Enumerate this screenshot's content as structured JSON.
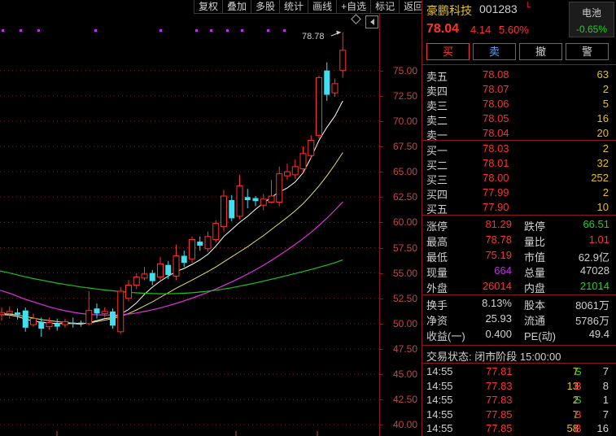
{
  "toolbar": {
    "items": [
      "复权",
      "叠加",
      "多股",
      "统计",
      "画线",
      "+自选",
      "标记",
      "返回"
    ]
  },
  "colors": {
    "up": "#ff3030",
    "down": "#40e0f0",
    "ma5": "#ffffff",
    "ma10": "#e8e060",
    "ma20": "#e030e0",
    "ma60": "#20c020",
    "marker": "#c030e0",
    "grid": "#8a1a1a"
  },
  "chart": {
    "high_label": "78.78",
    "y_ticks": [
      "75.00",
      "72.50",
      "70.00",
      "67.50",
      "65.00",
      "62.50",
      "60.00",
      "57.50",
      "55.00",
      "52.50",
      "50.00",
      "47.50",
      "45.00",
      "42.50",
      "40.00"
    ]
  },
  "chart_data": {
    "type": "candlestick",
    "ylim": [
      38.9,
      80.6
    ],
    "y_ticks": [
      75.0,
      72.5,
      70.0,
      67.5,
      65.0,
      62.5,
      60.0,
      57.5,
      55.0,
      52.5,
      50.0,
      47.5,
      45.0,
      42.5,
      40.0
    ],
    "high_annotation": 78.78,
    "candles": [
      {
        "o": 50.9,
        "c": 51.1,
        "h": 51.6,
        "l": 50.3
      },
      {
        "o": 51.0,
        "c": 51.2,
        "h": 51.7,
        "l": 50.5
      },
      {
        "o": 51.1,
        "c": 50.9,
        "h": 51.5,
        "l": 50.4
      },
      {
        "o": 51.3,
        "c": 49.6,
        "h": 51.6,
        "l": 49.2
      },
      {
        "o": 49.9,
        "c": 50.5,
        "h": 51.0,
        "l": 49.7
      },
      {
        "o": 50.2,
        "c": 49.5,
        "h": 50.6,
        "l": 48.7
      },
      {
        "o": 49.7,
        "c": 50.1,
        "h": 50.6,
        "l": 49.4
      },
      {
        "o": 50.0,
        "c": 49.7,
        "h": 50.5,
        "l": 49.3
      },
      {
        "o": 49.9,
        "c": 50.2,
        "h": 50.5,
        "l": 49.6
      },
      {
        "o": 50.1,
        "c": 50.0,
        "h": 50.6,
        "l": 49.6
      },
      {
        "o": 50.1,
        "c": 50.0,
        "h": 50.3,
        "l": 49.7
      },
      {
        "o": 50.0,
        "c": 51.3,
        "h": 53.2,
        "l": 49.8
      },
      {
        "o": 51.5,
        "c": 51.0,
        "h": 52.0,
        "l": 50.5
      },
      {
        "o": 51.0,
        "c": 51.2,
        "h": 51.6,
        "l": 50.6
      },
      {
        "o": 51.2,
        "c": 49.8,
        "h": 51.5,
        "l": 49.5
      },
      {
        "o": 49.2,
        "c": 53.2,
        "h": 53.6,
        "l": 49.0
      },
      {
        "o": 52.5,
        "c": 53.8,
        "h": 54.3,
        "l": 52.2
      },
      {
        "o": 53.8,
        "c": 54.6,
        "h": 55.0,
        "l": 53.4
      },
      {
        "o": 54.5,
        "c": 54.9,
        "h": 55.6,
        "l": 54.3
      },
      {
        "o": 55.0,
        "c": 54.2,
        "h": 55.3,
        "l": 53.8
      },
      {
        "o": 54.6,
        "c": 55.9,
        "h": 56.6,
        "l": 54.3
      },
      {
        "o": 55.8,
        "c": 54.8,
        "h": 56.2,
        "l": 54.4
      },
      {
        "o": 54.7,
        "c": 56.7,
        "h": 57.8,
        "l": 54.3
      },
      {
        "o": 56.7,
        "c": 56.0,
        "h": 57.2,
        "l": 55.6
      },
      {
        "o": 56.4,
        "c": 58.3,
        "h": 58.6,
        "l": 56.0
      },
      {
        "o": 58.1,
        "c": 57.7,
        "h": 58.6,
        "l": 57.2
      },
      {
        "o": 57.4,
        "c": 58.6,
        "h": 59.1,
        "l": 57.1
      },
      {
        "o": 58.3,
        "c": 59.9,
        "h": 60.2,
        "l": 58.0
      },
      {
        "o": 59.6,
        "c": 62.6,
        "h": 63.2,
        "l": 59.1
      },
      {
        "o": 62.2,
        "c": 60.4,
        "h": 62.7,
        "l": 60.1
      },
      {
        "o": 60.6,
        "c": 63.6,
        "h": 64.7,
        "l": 60.3
      },
      {
        "o": 62.5,
        "c": 62.2,
        "h": 63.3,
        "l": 61.4
      },
      {
        "o": 62.4,
        "c": 62.1,
        "h": 62.6,
        "l": 61.6
      },
      {
        "o": 61.7,
        "c": 62.3,
        "h": 62.8,
        "l": 61.2
      },
      {
        "o": 62.0,
        "c": 62.6,
        "h": 64.2,
        "l": 61.9
      },
      {
        "o": 62.0,
        "c": 64.8,
        "h": 65.5,
        "l": 61.6
      },
      {
        "o": 64.6,
        "c": 65.0,
        "h": 65.8,
        "l": 64.2
      },
      {
        "o": 64.7,
        "c": 65.5,
        "h": 66.2,
        "l": 64.3
      },
      {
        "o": 65.3,
        "c": 66.8,
        "h": 67.5,
        "l": 65.0
      },
      {
        "o": 66.6,
        "c": 68.1,
        "h": 68.6,
        "l": 66.3
      },
      {
        "o": 68.6,
        "c": 74.3,
        "h": 74.5,
        "l": 68.3
      },
      {
        "o": 75.0,
        "c": 72.6,
        "h": 75.8,
        "l": 72.0
      },
      {
        "o": 72.8,
        "c": 73.7,
        "h": 74.2,
        "l": 72.4
      },
      {
        "o": 75.0,
        "c": 77.0,
        "h": 78.78,
        "l": 74.3
      }
    ],
    "ma": [
      {
        "name": "MA5",
        "values": [
          50.9,
          50.85,
          50.7,
          50.45,
          50.25,
          50.15,
          50.05,
          50.0,
          50.0,
          50.0,
          49.95,
          50.1,
          50.3,
          50.5,
          50.6,
          50.95,
          51.4,
          52.05,
          52.9,
          53.6,
          54.2,
          54.7,
          55.15,
          55.45,
          55.85,
          56.3,
          56.85,
          57.65,
          58.6,
          59.3,
          60.0,
          60.6,
          61.3,
          61.9,
          62.5,
          63.0,
          63.4,
          64.0,
          64.9,
          66.4,
          68.1,
          69.4,
          70.5,
          72.0
        ]
      },
      {
        "name": "MA10",
        "values": [
          51.0,
          50.95,
          50.85,
          50.7,
          50.55,
          50.4,
          50.3,
          50.2,
          50.12,
          50.05,
          50.0,
          50.05,
          50.2,
          50.35,
          50.5,
          50.72,
          51.0,
          51.35,
          51.75,
          52.15,
          52.6,
          53.05,
          53.5,
          53.9,
          54.3,
          54.72,
          55.15,
          55.6,
          56.1,
          56.6,
          57.1,
          57.6,
          58.15,
          58.7,
          59.3,
          59.9,
          60.5,
          61.15,
          61.85,
          62.7,
          63.6,
          64.6,
          65.7,
          66.9
        ]
      },
      {
        "name": "MA20",
        "values": [
          53.3,
          53.0,
          52.7,
          52.4,
          52.15,
          51.9,
          51.65,
          51.45,
          51.27,
          51.12,
          51.0,
          50.92,
          50.87,
          50.85,
          50.85,
          50.88,
          50.95,
          51.05,
          51.2,
          51.37,
          51.55,
          51.77,
          52.0,
          52.25,
          52.52,
          52.8,
          53.1,
          53.42,
          53.77,
          54.12,
          54.5,
          54.9,
          55.32,
          55.77,
          56.25,
          56.75,
          57.27,
          57.82,
          58.4,
          59.02,
          59.7,
          60.42,
          61.2,
          62.02
        ]
      },
      {
        "name": "MA60",
        "values": [
          55.2,
          55.0,
          54.8,
          54.62,
          54.45,
          54.3,
          54.15,
          54.0,
          53.87,
          53.75,
          53.62,
          53.52,
          53.42,
          53.32,
          53.24,
          53.16,
          53.1,
          53.04,
          53.0,
          52.97,
          52.95,
          52.95,
          52.97,
          53.0,
          53.05,
          53.12,
          53.2,
          53.3,
          53.42,
          53.55,
          53.7,
          53.85,
          54.02,
          54.2,
          54.38,
          54.56,
          54.75,
          54.95,
          55.15,
          55.35,
          55.56,
          55.78,
          56.02,
          56.3
        ]
      }
    ]
  },
  "stock": {
    "name": "豪鹏科技",
    "code": "001283",
    "flag": "L",
    "price": "78.04",
    "change": "4.14",
    "change_pct": "5.60%",
    "sector_name": "电池",
    "sector_change": "-0.65%"
  },
  "buttons": {
    "buy": "买",
    "sell": "卖",
    "cancel": "撤",
    "alert": "警"
  },
  "asks": [
    {
      "label": "卖五",
      "price": "78.08",
      "vol": "63"
    },
    {
      "label": "卖四",
      "price": "78.07",
      "vol": "2"
    },
    {
      "label": "卖三",
      "price": "78.06",
      "vol": "5"
    },
    {
      "label": "卖二",
      "price": "78.05",
      "vol": "16"
    },
    {
      "label": "卖一",
      "price": "78.04",
      "vol": "20"
    }
  ],
  "bids": [
    {
      "label": "买一",
      "price": "78.03",
      "vol": "2"
    },
    {
      "label": "买二",
      "price": "78.01",
      "vol": "32"
    },
    {
      "label": "买三",
      "price": "78.00",
      "vol": "252"
    },
    {
      "label": "买四",
      "price": "77.99",
      "vol": "2"
    },
    {
      "label": "买五",
      "price": "77.90",
      "vol": "10"
    }
  ],
  "quote": [
    {
      "l1": "涨停",
      "v1": "81.29",
      "c1": "red",
      "l2": "跌停",
      "v2": "66.51",
      "c2": "green"
    },
    {
      "l1": "最高",
      "v1": "78.78",
      "c1": "red",
      "l2": "量比",
      "v2": "1.01",
      "c2": "red"
    },
    {
      "l1": "最低",
      "v1": "75.19",
      "c1": "red",
      "l2": "市值",
      "v2": "62.9亿",
      "c2": "white"
    },
    {
      "l1": "现量",
      "v1": "664",
      "c1": "purple",
      "l2": "总量",
      "v2": "47028",
      "c2": "white"
    },
    {
      "l1": "外盘",
      "v1": "26014",
      "c1": "red",
      "l2": "内盘",
      "v2": "21014",
      "c2": "green"
    }
  ],
  "fundamentals": [
    {
      "l1": "换手",
      "v1": "8.13%",
      "l2": "股本",
      "v2": "8061万"
    },
    {
      "l1": "净资",
      "v1": "25.93",
      "l2": "流通",
      "v2": "5786万"
    },
    {
      "l1": "收益(一)",
      "v1": "0.400",
      "l2": "PE(动)",
      "v2": "49.4"
    }
  ],
  "status": {
    "label": "交易状态:",
    "value": "闭市阶段 15:00:00"
  },
  "ticks": [
    {
      "time": "14:55",
      "price": "77.81",
      "vol": "7",
      "side": "S",
      "count": "7"
    },
    {
      "time": "14:55",
      "price": "77.83",
      "vol": "13",
      "side": "B",
      "count": "8"
    },
    {
      "time": "14:55",
      "price": "77.83",
      "vol": "2",
      "side": "S",
      "count": "1"
    },
    {
      "time": "14:55",
      "price": "77.85",
      "vol": "7",
      "side": "B",
      "count": "7"
    },
    {
      "time": "14:55",
      "price": "77.85",
      "vol": "58",
      "side": "B",
      "count": "16"
    }
  ]
}
